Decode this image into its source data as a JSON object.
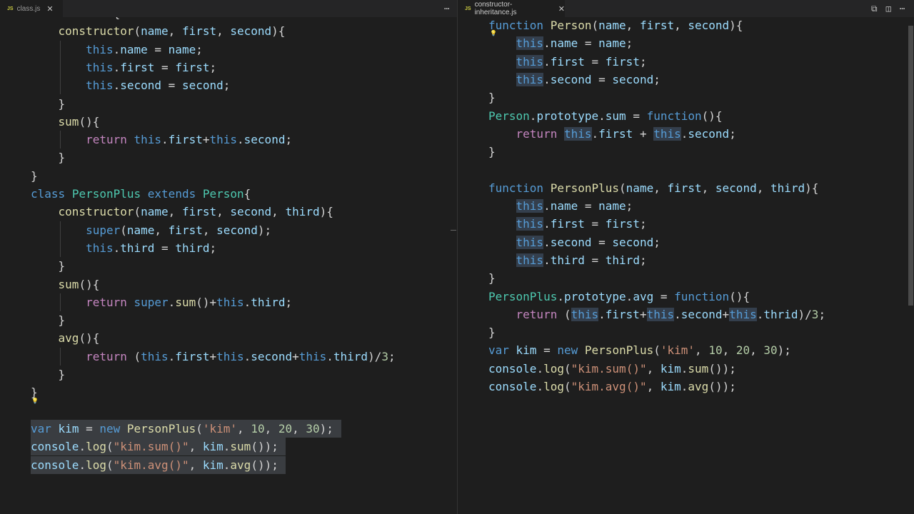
{
  "left_tab": {
    "label": "class.js",
    "icon": "js-file-icon",
    "badge": "JS"
  },
  "right_tab": {
    "label": "constructor-inheritance.js",
    "icon": "js-file-icon",
    "badge": "JS"
  },
  "left_code": [
    "class Person{",
    "    constructor(name, first, second){",
    "        this.name = name;",
    "        this.first = first;",
    "        this.second = second;",
    "    }",
    "    sum(){",
    "        return this.first+this.second;",
    "    }",
    "}",
    "class PersonPlus extends Person{",
    "    constructor(name, first, second, third){",
    "        super(name, first, second);",
    "        this.third = third;",
    "    }",
    "    sum(){",
    "        return super.sum()+this.third;",
    "    }",
    "    avg(){",
    "        return (this.first+this.second+this.third)/3;",
    "    }",
    "}",
    "",
    "var kim = new PersonPlus('kim', 10, 20, 30);",
    "console.log(\"kim.sum()\", kim.sum());",
    "console.log(\"kim.avg()\", kim.avg());"
  ],
  "right_code": [
    "function Person(name, first, second){",
    "    this.name = name;",
    "    this.first = first;",
    "    this.second = second;",
    "}",
    "Person.prototype.sum = function(){",
    "    return this.first + this.second;",
    "}",
    "",
    "function PersonPlus(name, first, second, third){",
    "    this.name = name;",
    "    this.first = first;",
    "    this.second = second;",
    "    this.third = third;",
    "}",
    "PersonPlus.prototype.avg = function(){",
    "    return (this.first+this.second+this.thrid)/3;",
    "}",
    "var kim = new PersonPlus('kim', 10, 20, 30);",
    "console.log(\"kim.sum()\", kim.sum());",
    "console.log(\"kim.avg()\", kim.avg());"
  ],
  "icons": {
    "more": "ellipsis-icon",
    "compare": "open-changes-icon",
    "split": "split-editor-icon",
    "lightbulb": "lightbulb-icon"
  }
}
